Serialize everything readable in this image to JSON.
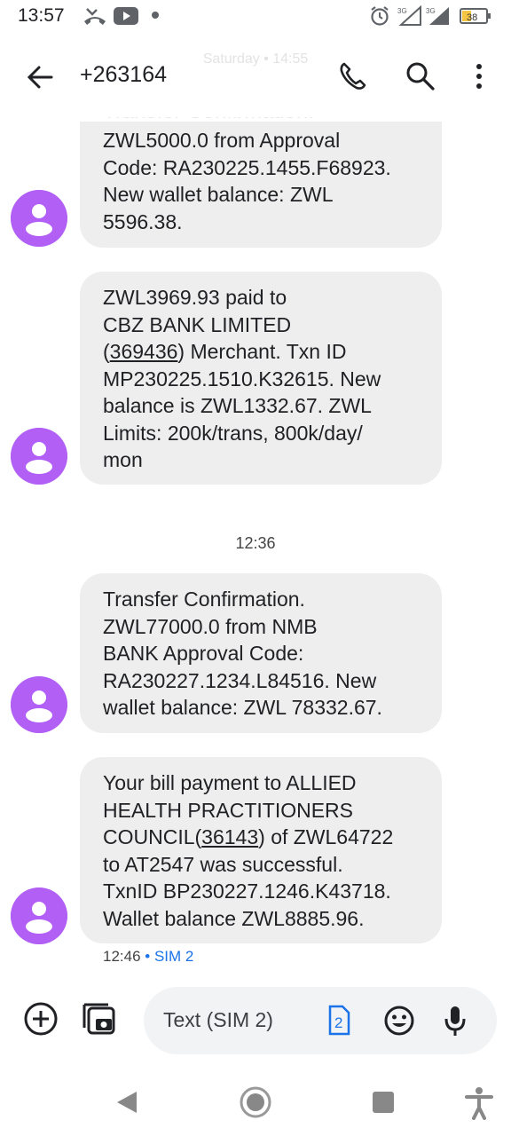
{
  "status_bar": {
    "time": "13:57",
    "battery": "38",
    "network_1": "3G",
    "network_2": "3G"
  },
  "header": {
    "contact": "+263164",
    "faded_date": "Saturday • 14:55"
  },
  "conversation": {
    "partial_header": "Transfer Confirmation.",
    "messages": [
      {
        "lines": [
          "ZWL5000.0 from  Approval",
          "Code: RA230225.1455.F68923.",
          "New wallet balance: ZWL",
          "5596.38."
        ]
      },
      {
        "line1": "ZWL3969.93 paid to",
        "line2": "CBZ BANK LIMITED",
        "line3_pre": "(",
        "line3_link": "369436",
        "line3_post": ") Merchant. Txn ID",
        "line4": "MP230225.1510.K32615. New",
        "line5": "balance is ZWL1332.67. ZWL",
        "line6": "Limits: 200k/trans, 800k/day/",
        "line7": "mon"
      },
      {
        "lines": [
          "Transfer Confirmation.",
          "ZWL77000.0 from NMB",
          "BANK Approval Code:",
          "RA230227.1234.L84516. New",
          "wallet balance: ZWL 78332.67."
        ]
      },
      {
        "line1": "Your bill payment to ALLIED",
        "line2": "HEALTH PRACTITIONERS",
        "line3_pre": "COUNCIL(",
        "line3_link": "36143",
        "line3_post": ") of ZWL64722",
        "line4": "to AT2547 was successful.",
        "line5": "TxnID BP230227.1246.K43718.",
        "line6": "Wallet balance ZWL8885.96."
      }
    ],
    "time_divider": "12:36",
    "last_meta_time": "12:46",
    "last_meta_sep": "•",
    "last_meta_sim": "SIM 2"
  },
  "compose": {
    "placeholder": "Text (SIM 2)",
    "sim_badge": "2"
  },
  "colors": {
    "avatar": "#b25ff5",
    "bubble": "#eeeeee",
    "accent": "#1a73e8"
  }
}
